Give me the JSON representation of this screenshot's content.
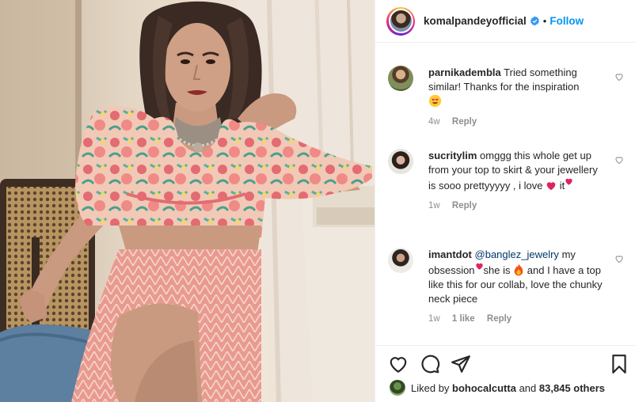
{
  "post": {
    "image_alt": "Woman in floral puff-sleeve crop top and pink printed skirt seated on a cane chair"
  },
  "header": {
    "username": "komalpandeyofficial",
    "separator": "•",
    "follow_label": "Follow"
  },
  "comments": [
    {
      "username": "parnikadembla",
      "text": "Tried something similar! Thanks for the inspiration",
      "time": "4w",
      "reply_label": "Reply"
    },
    {
      "username": "sucritylim",
      "text": "omggg this whole get up from your top to skirt & your jewellery is sooo prettyyyyy , i love",
      "text_end": "it",
      "time": "1w",
      "reply_label": "Reply"
    },
    {
      "username": "imantdot",
      "mention": "@banglez_jewelry",
      "text_a": "my obsession",
      "text_b": "she is",
      "text_c": "and I have a top like this for our collab, love the chunky neck piece",
      "time": "1w",
      "likes": "1 like",
      "reply_label": "Reply"
    }
  ],
  "likes_summary": {
    "prefix": "Liked by",
    "user": "bohocalcutta",
    "middle": "and",
    "others": "83,845 others"
  },
  "colors": {
    "link_blue": "#0095f6",
    "mention_blue": "#00376b",
    "meta_gray": "#8e8e8e",
    "heart_red": "#e0245e"
  }
}
